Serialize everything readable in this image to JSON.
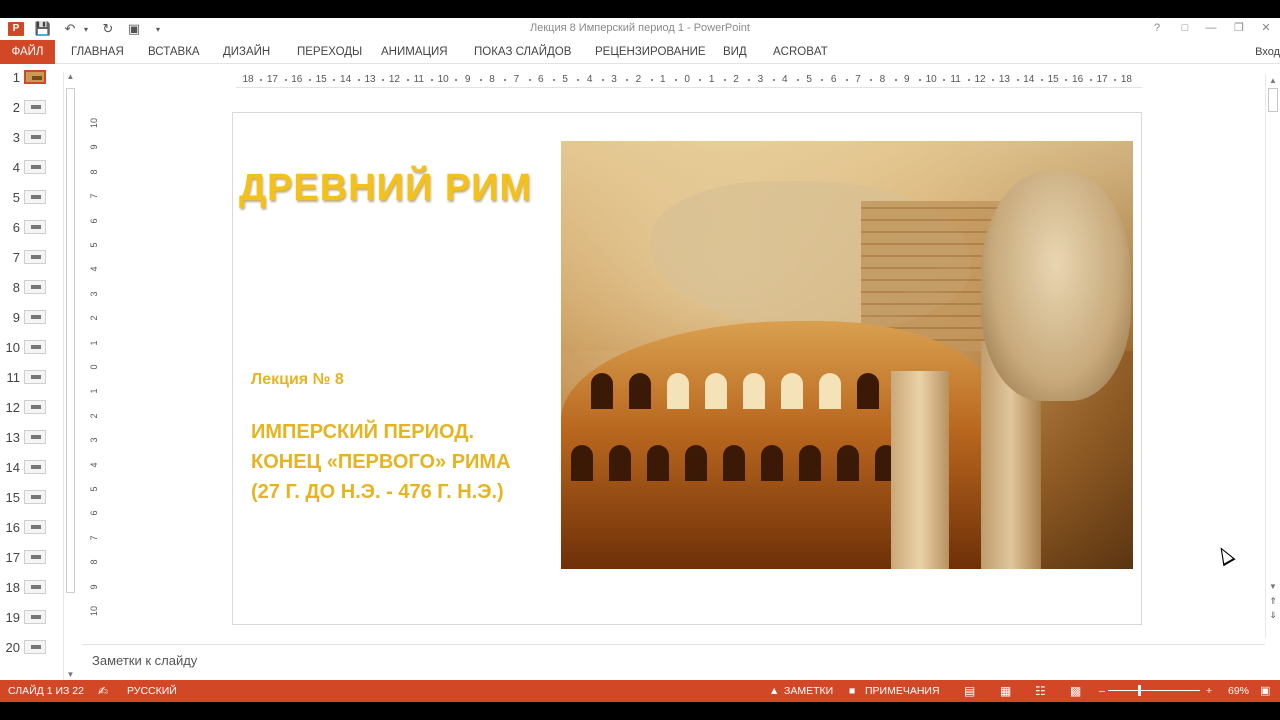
{
  "window": {
    "title": "Лекция 8 Имперский период 1 - PowerPoint",
    "app_logo": "P",
    "signin": "Вход",
    "icons": [
      "powerpoint-logo-icon",
      "save-icon",
      "undo-icon",
      "redo-icon",
      "present-from-start-icon",
      "customize-toolbar-icon",
      "help-icon",
      "ribbon-display-icon",
      "minimize-icon",
      "restore-icon",
      "close-icon"
    ]
  },
  "ribbon": {
    "file": "ФАЙЛ",
    "tabs": [
      "ГЛАВНАЯ",
      "ВСТАВКА",
      "ДИЗАЙН",
      "ПЕРЕХОДЫ",
      "АНИМАЦИЯ",
      "ПОКАЗ СЛАЙДОВ",
      "РЕЦЕНЗИРОВАНИЕ",
      "ВИД",
      "ACROBAT"
    ]
  },
  "thumbnails": {
    "numbers": [
      "1",
      "2",
      "3",
      "4",
      "5",
      "6",
      "7",
      "8",
      "9",
      "10",
      "11",
      "12",
      "13",
      "14",
      "15",
      "16",
      "17",
      "18",
      "19",
      "20"
    ],
    "active_index": 1
  },
  "rulers": {
    "horizontal": [
      "18",
      "17",
      "16",
      "15",
      "14",
      "13",
      "12",
      "11",
      "10",
      "9",
      "8",
      "7",
      "6",
      "5",
      "4",
      "3",
      "2",
      "1",
      "0",
      "1",
      "2",
      "3",
      "4",
      "5",
      "6",
      "7",
      "8",
      "9",
      "10",
      "11",
      "12",
      "13",
      "14",
      "15",
      "16",
      "17",
      "18"
    ],
    "vertical": [
      "10",
      "9",
      "8",
      "7",
      "6",
      "5",
      "4",
      "3",
      "2",
      "1",
      "0",
      "1",
      "2",
      "3",
      "4",
      "5",
      "6",
      "7",
      "8",
      "9",
      "10"
    ]
  },
  "slide": {
    "title": "ДРЕВНИЙ РИМ",
    "lecture": "Лекция № 8",
    "subtitle_lines": [
      "ИМПЕРСКИЙ ПЕРИОД.",
      "КОНЕЦ «ПЕРВОГО» РИМА",
      "(27 Г. ДО Н.Э. - 476 Г. Н.Э.)"
    ],
    "colors": {
      "title": "#f3c11a",
      "text": "#e6b422"
    }
  },
  "notes": {
    "placeholder": "Заметки к слайду"
  },
  "status": {
    "slide_counter": "СЛАЙД 1 ИЗ 22",
    "language": "РУССКИЙ",
    "notes_btn": "ЗАМЕТКИ",
    "comments_btn": "ПРИМЕЧАНИЯ",
    "zoom": "69%",
    "accent": "#d24726"
  }
}
